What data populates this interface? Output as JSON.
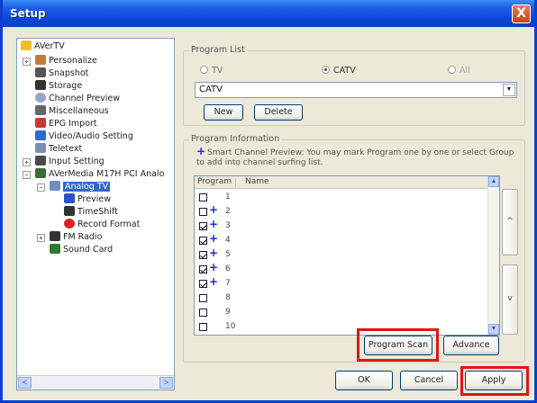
{
  "window": {
    "title": "Setup",
    "close_label": "X"
  },
  "tree": {
    "items": [
      {
        "label": "AVerTV",
        "icon": "app-icon"
      },
      {
        "label": "Personalize",
        "icon": "personalize-icon"
      },
      {
        "label": "Snapshot",
        "icon": "camera-icon"
      },
      {
        "label": "Storage",
        "icon": "storage-icon"
      },
      {
        "label": "Channel Preview",
        "icon": "eye-icon"
      },
      {
        "label": "Miscellaneous",
        "icon": "wrench-icon"
      },
      {
        "label": "EPG Import",
        "icon": "epg-icon"
      },
      {
        "label": "Video/Audio Setting",
        "icon": "tools-icon"
      },
      {
        "label": "Teletext",
        "icon": "teletext-icon"
      },
      {
        "label": "Input Setting",
        "icon": "input-icon"
      },
      {
        "label": "AVerMedia M17H PCI Analo",
        "icon": "card-icon"
      },
      {
        "label": "Analog TV",
        "icon": "tv-icon"
      },
      {
        "label": "Preview",
        "icon": "check-icon"
      },
      {
        "label": "TimeShift",
        "icon": "film-icon"
      },
      {
        "label": "Record Format",
        "icon": "record-icon"
      },
      {
        "label": "FM Radio",
        "icon": "radio-icon"
      },
      {
        "label": "Sound Card",
        "icon": "soundcard-icon"
      }
    ],
    "scroll_left": "<",
    "scroll_right": ">"
  },
  "program_list": {
    "group_label": "Program List",
    "radios": [
      {
        "label": "TV",
        "selected": false
      },
      {
        "label": "CATV",
        "selected": true
      },
      {
        "label": "All",
        "selected": false
      }
    ],
    "combo_value": "CATV",
    "combo_arrow": "▼",
    "new_label": "New",
    "delete_label": "Delete"
  },
  "program_info": {
    "group_label": "Program Information",
    "hint_plus": "+",
    "hint": "Smart Channel Preview: You may mark Program one by one or select Group to add into channel surfing list.",
    "col_program": "Program",
    "col_name": "Name",
    "rows": [
      {
        "num": "1",
        "checked": false,
        "plus": ""
      },
      {
        "num": "2",
        "checked": false,
        "plus": "+"
      },
      {
        "num": "3",
        "checked": true,
        "plus": "+"
      },
      {
        "num": "4",
        "checked": true,
        "plus": "+"
      },
      {
        "num": "5",
        "checked": true,
        "plus": "+"
      },
      {
        "num": "6",
        "checked": true,
        "plus": "+"
      },
      {
        "num": "7",
        "checked": true,
        "plus": "+"
      },
      {
        "num": "8",
        "checked": false,
        "plus": ""
      },
      {
        "num": "9",
        "checked": false,
        "plus": ""
      },
      {
        "num": "10",
        "checked": false,
        "plus": ""
      }
    ],
    "scroll_up": "▲",
    "scroll_down": "▼",
    "group_up": "^",
    "group_down": "v",
    "scan_label": "Program Scan",
    "advance_label": "Advance"
  },
  "footer": {
    "ok_label": "OK",
    "cancel_label": "Cancel",
    "apply_label": "Apply"
  },
  "colors": {
    "highlight": "#e01616",
    "titlebar": "#0a47d6",
    "selection": "#316ac5"
  }
}
